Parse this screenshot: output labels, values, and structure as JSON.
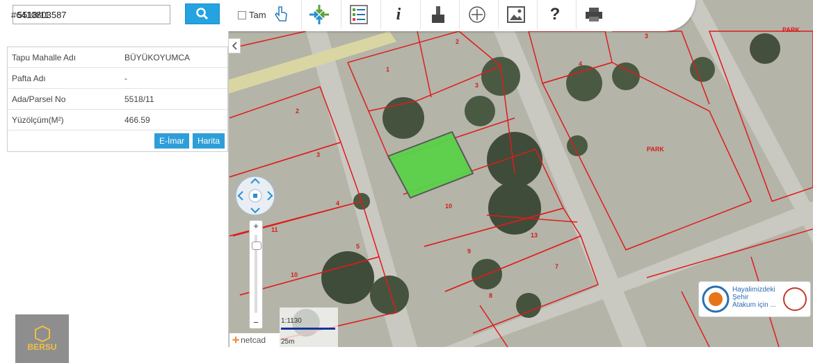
{
  "search": {
    "value": "5518/11",
    "placeholder": "",
    "label": "#6410803587"
  },
  "toolbar": {
    "checkbox_label": "Tam"
  },
  "parcel_info": {
    "rows": [
      {
        "key": "Tapu Mahalle Adı",
        "value": "BÜYÜKOYUMCA"
      },
      {
        "key": "Pafta Adı",
        "value": "-"
      },
      {
        "key": "Ada/Parsel No",
        "value": "5518/11"
      },
      {
        "key": "Yüzölçüm(M²)",
        "value": "466.59"
      }
    ],
    "buttons": [
      "E-İmar",
      "Harita"
    ]
  },
  "logo": {
    "text": "BERSU"
  },
  "scale": {
    "ratio": "1:1130",
    "distance": "25m"
  },
  "netcad": {
    "label": "netcad"
  },
  "ad": {
    "line1": "Hayalimizdeki",
    "line2": "Şehir",
    "line3": "Atakum için ..."
  },
  "map_labels": {
    "park_top": "PARK",
    "park_mid": "PARK",
    "parcels": [
      "1",
      "2",
      "3",
      "4",
      "5",
      "6",
      "7",
      "8",
      "9",
      "10",
      "11",
      "12",
      "13"
    ]
  },
  "colors": {
    "accent": "#25a3e0",
    "parcel_highlight": "#5bd14a",
    "parcel_lines": "#e01b1b"
  }
}
